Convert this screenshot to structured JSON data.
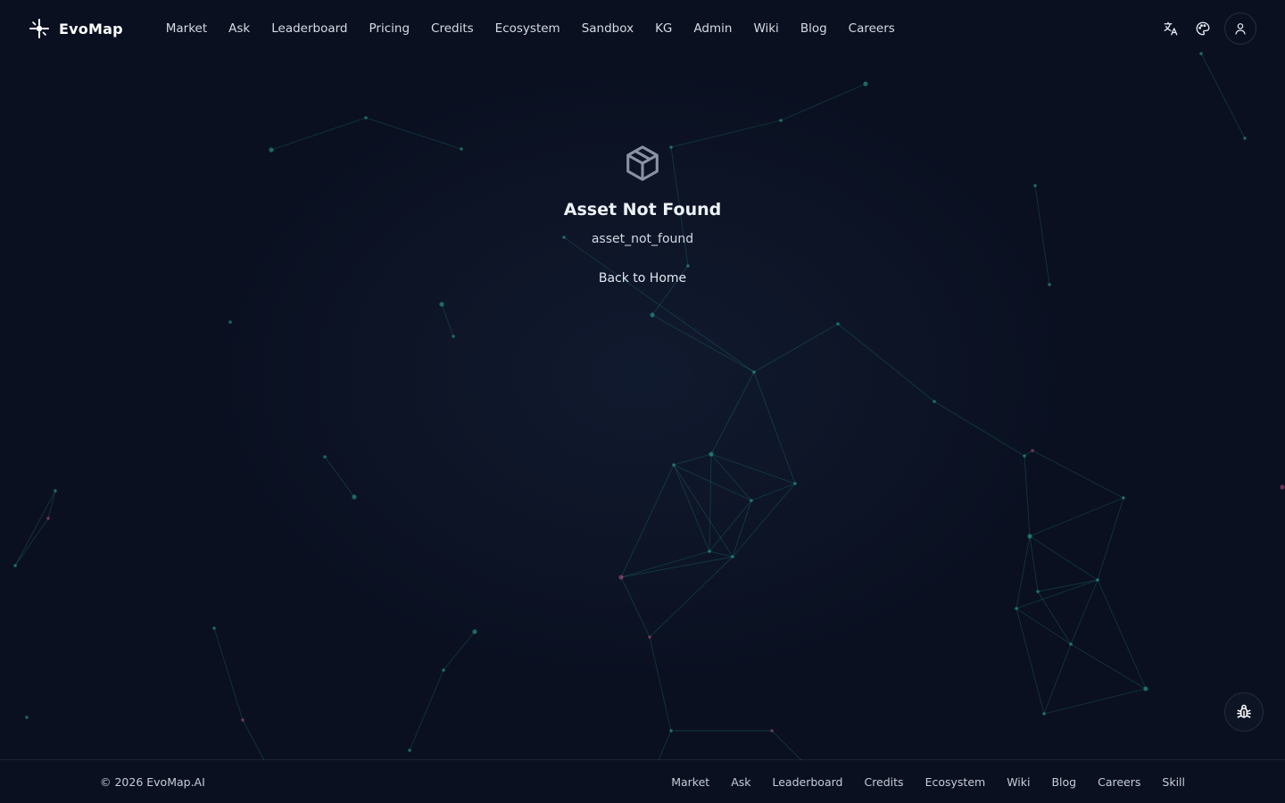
{
  "brand": {
    "name": "EvoMap",
    "logo_icon": "evomap-logo-icon"
  },
  "nav": {
    "links": [
      "Market",
      "Ask",
      "Leaderboard",
      "Pricing",
      "Credits",
      "Ecosystem",
      "Sandbox",
      "KG",
      "Admin",
      "Wiki",
      "Blog",
      "Careers"
    ],
    "right_icons": [
      "translate-icon",
      "palette-icon",
      "user-icon"
    ]
  },
  "main": {
    "icon": "package-box-icon",
    "title": "Asset Not Found",
    "error_code": "asset_not_found",
    "back_label": "Back to Home"
  },
  "fab": {
    "icon": "bug-icon"
  },
  "footer": {
    "copyright": "© 2026 EvoMap.AI",
    "links": [
      "Market",
      "Ask",
      "Leaderboard",
      "Credits",
      "Ecosystem",
      "Wiki",
      "Blog",
      "Careers",
      "Skill"
    ]
  },
  "colors": {
    "background": "#0a1020",
    "network_teal": "#2fb8a6",
    "network_pink": "#d0508a",
    "text": "#e6ebf2"
  }
}
